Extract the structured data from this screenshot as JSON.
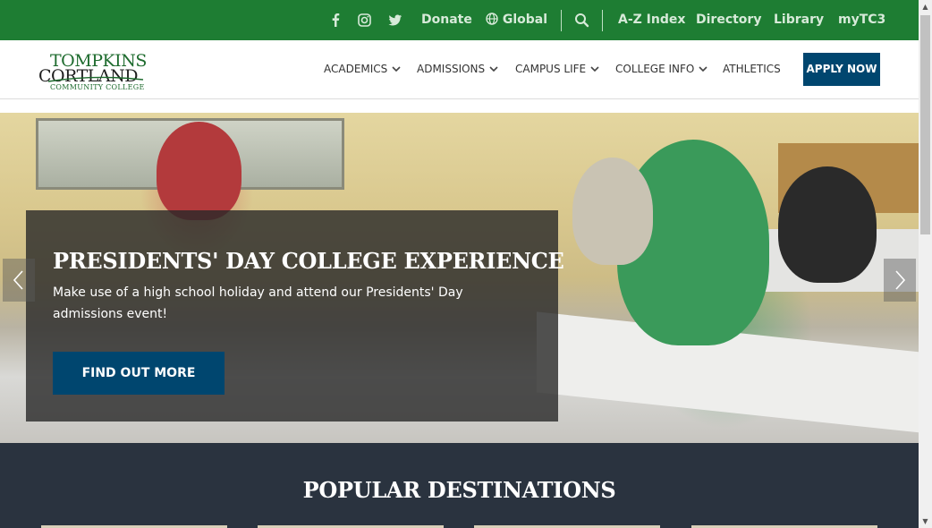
{
  "topbar": {
    "social": [
      "facebook-icon",
      "instagram-icon",
      "twitter-icon"
    ],
    "donate": "Donate",
    "global": "Global",
    "links": [
      "A-Z Index",
      "Directory",
      "Library",
      "myTC3"
    ]
  },
  "logo": {
    "line1": "TOMPKINS",
    "line2": "CORTLAND",
    "line3": "COMMUNITY COLLEGE"
  },
  "nav": {
    "items": [
      "ACADEMICS",
      "ADMISSIONS",
      "CAMPUS LIFE",
      "COLLEGE INFO",
      "ATHLETICS"
    ],
    "apply": "APPLY NOW"
  },
  "hero": {
    "title": "PRESIDENTS' DAY COLLEGE EXPERIENCE",
    "description": "Make use of a high school holiday and attend our Presidents' Day admissions event!",
    "cta": "FIND OUT MORE"
  },
  "popular": {
    "title": "POPULAR DESTINATIONS"
  },
  "colors": {
    "topbar": "#1e7d33",
    "primary_button": "#00466f",
    "popular_bg": "#2a333f"
  }
}
